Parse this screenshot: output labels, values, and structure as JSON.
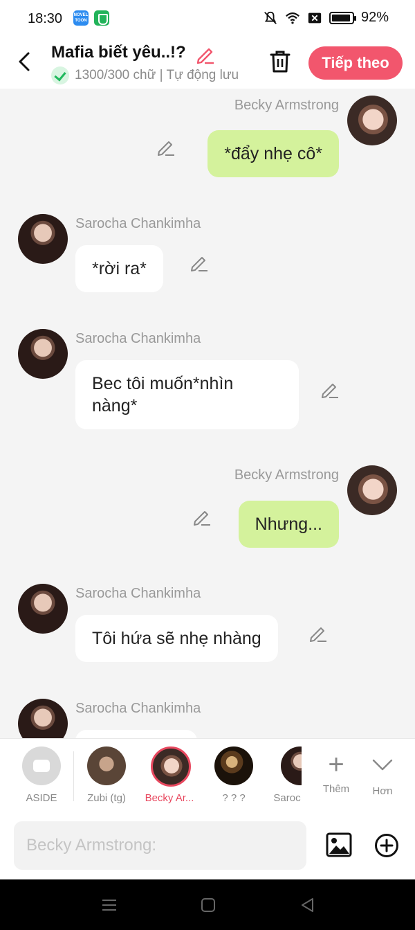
{
  "status_bar": {
    "time": "18:30",
    "novel_badge": "NOVEL TOON",
    "battery": "92%",
    "battery_level": 0.92
  },
  "header": {
    "title": "Mafia biết yêu..!?",
    "save_status": "1300/300 chữ | Tự động lưu",
    "next_label": "Tiếp theo",
    "accent_color": "#f2566d"
  },
  "messages": [
    {
      "sender": "Becky Armstrong",
      "text": "*đẩy nhẹ cô*",
      "side": "right"
    },
    {
      "sender": "Sarocha Chankimha",
      "text": "*rời ra*",
      "side": "left"
    },
    {
      "sender": "Sarocha Chankimha",
      "text": "Bec tôi muốn*nhìn nàng*",
      "side": "left"
    },
    {
      "sender": "Becky Armstrong",
      "text": "Nhưng...",
      "side": "right"
    },
    {
      "sender": "Sarocha Chankimha",
      "text": "Tôi hứa sẽ nhẹ nhàng",
      "side": "left"
    },
    {
      "sender": "Sarocha Chankimha",
      "text": "",
      "side": "left"
    }
  ],
  "roles": [
    {
      "label": "ASIDE",
      "icon": "aside-icon"
    },
    {
      "label": "Zubi (tg)"
    },
    {
      "label": "Becky Ar...",
      "active": true
    },
    {
      "label": "? ? ?"
    },
    {
      "label": "Saroc"
    }
  ],
  "role_actions": {
    "add_label": "Thêm",
    "more_label": "Hơn"
  },
  "input": {
    "placeholder": "Becky Armstrong:"
  },
  "colors": {
    "right_bubble": "#d4f29c",
    "left_bubble": "#ffffff",
    "active_role": "#e8485f"
  }
}
